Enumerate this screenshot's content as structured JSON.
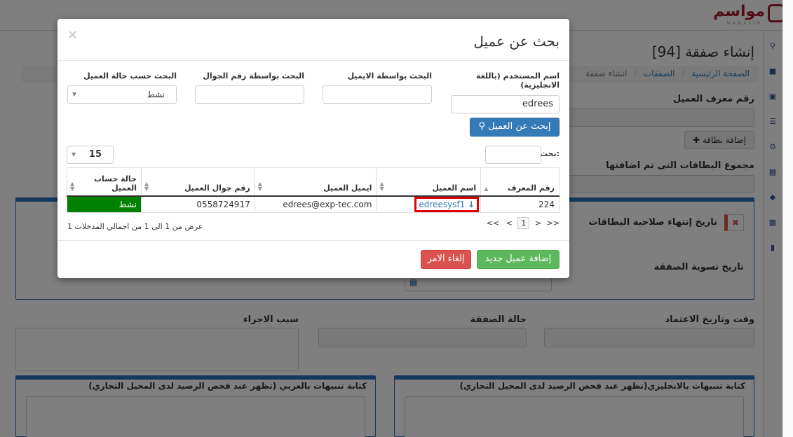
{
  "header": {
    "logo_text": "مواسم",
    "logo_sub": "MAWASIM"
  },
  "page": {
    "title": "إنشاء صفقة [94]",
    "breadcrumb": [
      "الصفحة الرئيسية",
      "الصفقات",
      "انشاء صفقة"
    ],
    "customer_id_label": "رقم معرف العميل",
    "add_card_label": "إضافة بطاقة",
    "cards_total_label": "مجموع البطاقات التى تم اضافتها",
    "card_expiry_label": "تاريخ إنتهاء صلاحية البطاقات",
    "settlement_date_label": "تاريخ تسوية الصفقة",
    "approval_label": "وقت وتاريخ الاعتماد",
    "deal_status_label": "حالة الصفقة",
    "action_reason_label": "سبب الاجراء",
    "notes_en_label": "كتابة تنبيهات بالانجليزي(تظهر عند فحص الرصيد لدى المحيل التجاري)",
    "notes_ar_label": "كتابة تنبيهات بالعربي (تظهر عند فحص الرصيد لدى المحيل التجاري)"
  },
  "modal": {
    "title": "بحث عن عميل",
    "close": "×",
    "filters": {
      "username_label": "اسم المستخدم (باللغة الانجليزية)",
      "username_value": "edrees",
      "email_label": "البحث بواسطة الايميل",
      "email_value": "",
      "mobile_label": "البحث بواسطة رقم الجوال",
      "mobile_value": "",
      "status_label": "البحث حسب حالة العميل",
      "status_value": "نشط"
    },
    "search_button": "إبحث عن العميل",
    "page_size": "15",
    "table_search_label": "بحث:",
    "table_search_value": "",
    "columns": [
      "رقم المعرف",
      "اسم العميل",
      "ايميل العميل",
      "رقم جوال العميل",
      "حالة حساب العميل"
    ],
    "rows": [
      {
        "id": "224",
        "name": "edreesysf1",
        "email": "edrees@exp-tec.com",
        "mobile": "0558724917",
        "status": "نشط"
      }
    ],
    "pagination": {
      "first": "<<",
      "prev": "<",
      "current": "1",
      "next": ">",
      "last": ">>"
    },
    "info": "عرض من 1 الى 1 من اجمالي المدخلات 1",
    "add_customer_button": "إضافة عميل جديد",
    "cancel_button": "إلغاء الامر"
  },
  "colors": {
    "primary": "#337ab7",
    "success": "#5cb85c",
    "danger": "#d9534f",
    "active_status": "#008000",
    "highlight": "#e00000",
    "brand": "#a31a2b"
  }
}
